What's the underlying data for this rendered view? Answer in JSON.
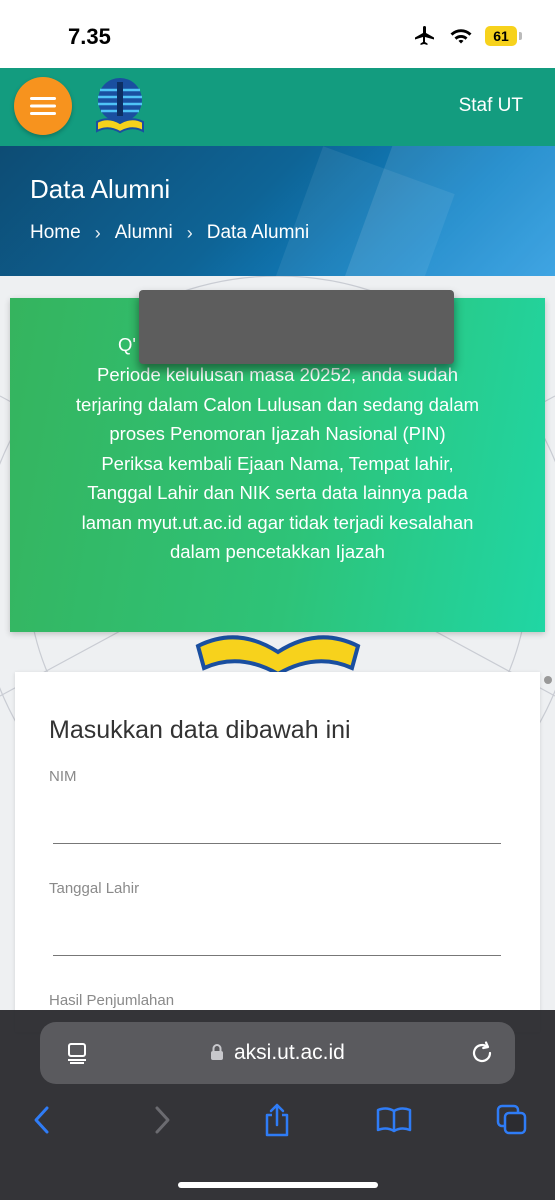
{
  "status": {
    "time": "7.35",
    "battery": "61"
  },
  "header": {
    "staff_link": "Staf UT"
  },
  "banner": {
    "title": "Data Alumni",
    "breadcrumb": [
      "Home",
      "Alumni",
      "Data Alumni"
    ],
    "separator": "›"
  },
  "notice": {
    "greeting": "Q'",
    "lines": [
      "Periode kelulusan masa 20252, anda sudah",
      "terjaring dalam Calon Lulusan dan sedang dalam",
      "proses Penomoran Ijazah Nasional (PIN)",
      "Periksa kembali Ejaan Nama, Tempat lahir,",
      "Tanggal Lahir dan NIK serta data lainnya pada",
      "laman myut.ut.ac.id agar tidak terjadi kesalahan",
      "dalam pencetakkan Ijazah"
    ]
  },
  "form": {
    "title": "Masukkan data dibawah ini",
    "fields": [
      {
        "label": "NIM",
        "value": ""
      },
      {
        "label": "Tanggal Lahir",
        "value": ""
      },
      {
        "label": "Hasil Penjumlahan",
        "value": ""
      }
    ]
  },
  "browser": {
    "url": "aksi.ut.ac.id"
  },
  "colors": {
    "header_green": "#139c7f",
    "menu_orange": "#f7931e",
    "notice_start": "#35b45e",
    "notice_end": "#20d6a4",
    "ios_blue": "#2f7cf6"
  }
}
